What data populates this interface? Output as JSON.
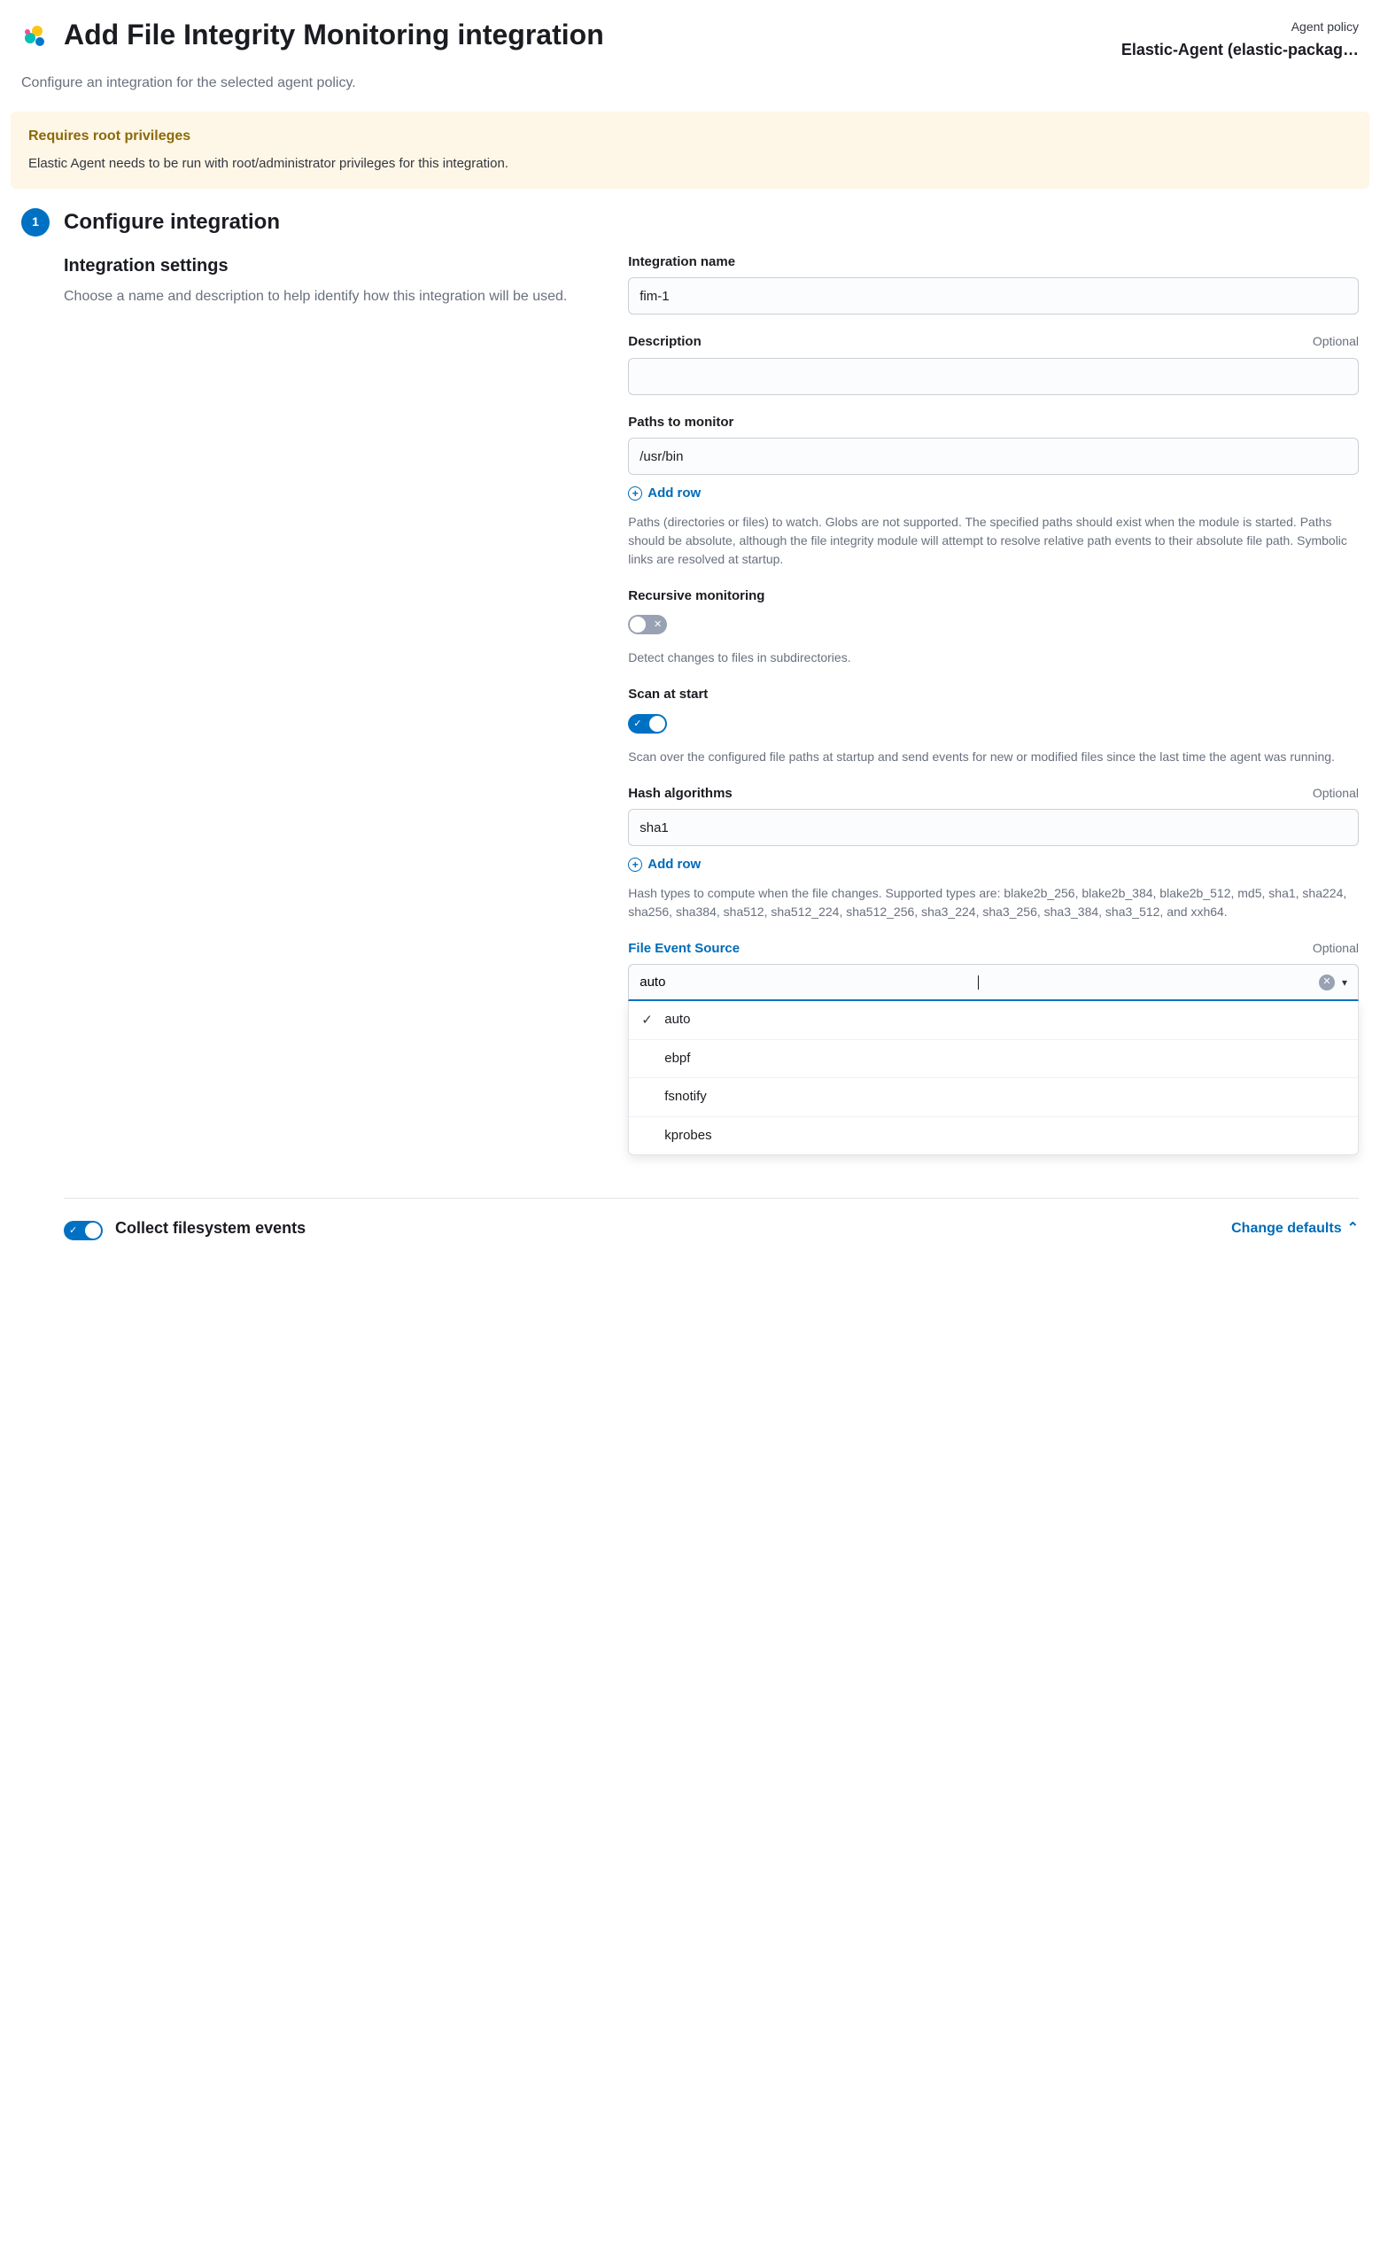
{
  "header": {
    "title": "Add File Integrity Monitoring integration",
    "policy_label": "Agent policy",
    "policy_value": "Elastic-Agent (elastic-packag…",
    "subtitle": "Configure an integration for the selected agent policy."
  },
  "callout": {
    "title": "Requires root privileges",
    "body": "Elastic Agent needs to be run with root/administrator privileges for this integration."
  },
  "step": {
    "number": "1",
    "title": "Configure integration"
  },
  "settings": {
    "title": "Integration settings",
    "description": "Choose a name and description to help identify how this integration will be used."
  },
  "fields": {
    "integration_name": {
      "label": "Integration name",
      "value": "fim-1"
    },
    "description": {
      "label": "Description",
      "optional": "Optional",
      "value": ""
    },
    "paths": {
      "label": "Paths to monitor",
      "value": "/usr/bin",
      "add_row": "Add row",
      "help": "Paths (directories or files) to watch. Globs are not supported. The specified paths should exist when the module is started. Paths should be absolute, although the file integrity module will attempt to resolve relative path events to their absolute file path. Symbolic links are resolved at startup."
    },
    "recursive": {
      "label": "Recursive monitoring",
      "help": "Detect changes to files in subdirectories."
    },
    "scan_start": {
      "label": "Scan at start",
      "help": "Scan over the configured file paths at startup and send events for new or modified files since the last time the agent was running."
    },
    "hash": {
      "label": "Hash algorithms",
      "optional": "Optional",
      "value": "sha1",
      "add_row": "Add row",
      "help": "Hash types to compute when the file changes. Supported types are: blake2b_256, blake2b_384, blake2b_512, md5, sha1, sha224, sha256, sha384, sha512, sha512_224, sha512_256, sha3_224, sha3_256, sha3_384, sha3_512, and xxh64."
    },
    "source": {
      "label": "File Event Source",
      "optional": "Optional",
      "value": "auto",
      "options": [
        "auto",
        "ebpf",
        "fsnotify",
        "kprobes"
      ]
    }
  },
  "footer": {
    "collect_label": "Collect filesystem events",
    "change_defaults": "Change defaults"
  }
}
